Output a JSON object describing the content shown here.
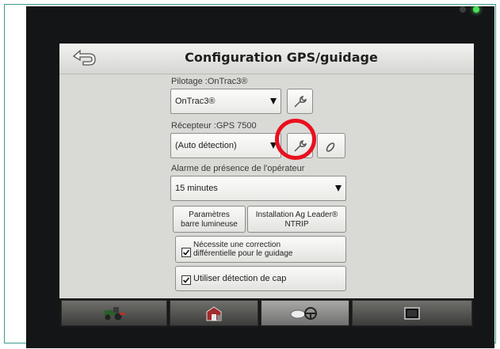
{
  "header": {
    "title": "Configuration GPS/guidage",
    "back_icon": "back-arrow-icon"
  },
  "steering": {
    "label": "Pilotage :OnTrac3®",
    "value": "OnTrac3®"
  },
  "receiver": {
    "label": "Récepteur :GPS 7500",
    "value": "(Auto détection)"
  },
  "alarm": {
    "label": "Alarme de présence de l'opérateur",
    "value": "15 minutes"
  },
  "buttons": {
    "lightbar_line1": "Paramètres",
    "lightbar_line2": "barre lumineuse",
    "ntrip_line1": "Installation Ag Leader®",
    "ntrip_line2": "NTRIP"
  },
  "checks": {
    "diff_line1": "Nécessite une correction",
    "diff_line2": "différentielle pour le guidage",
    "diff_checked": true,
    "heading_label": "Utiliser détection de cap",
    "heading_checked": true
  },
  "tabs": [
    {
      "icon": "tractor-icon",
      "active": false
    },
    {
      "icon": "barn-icon",
      "active": false
    },
    {
      "icon": "gps-steering-icon",
      "active": true
    },
    {
      "icon": "display-icon",
      "active": false
    }
  ],
  "colors": {
    "highlight_circle": "#e8101f",
    "led_green": "#4be05a"
  }
}
